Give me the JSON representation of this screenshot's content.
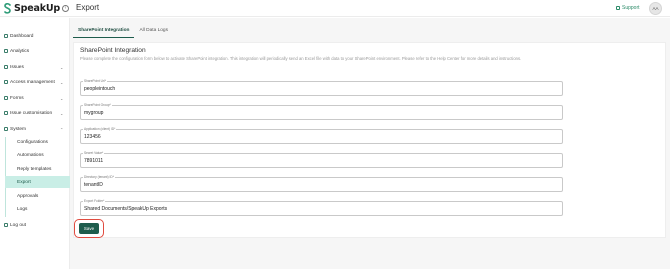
{
  "app": {
    "brand": "SpeakUp",
    "page_title": "Export",
    "support_label": "Support",
    "avatar_initials": "AA",
    "accent_color": "#1d5c4c"
  },
  "sidebar": {
    "items": [
      {
        "label": "Dashboard",
        "icon": "dashboard-icon"
      },
      {
        "label": "Analytics",
        "icon": "analytics-icon"
      },
      {
        "label": "Issues",
        "icon": "issues-icon",
        "chevron": "down"
      },
      {
        "label": "Access management",
        "icon": "access-icon",
        "chevron": "down"
      },
      {
        "label": "Forms",
        "icon": "forms-icon",
        "chevron": "down"
      },
      {
        "label": "Issue customisation",
        "icon": "customise-icon",
        "chevron": "down"
      },
      {
        "label": "System",
        "icon": "system-icon",
        "chevron": "up"
      }
    ],
    "system_subitems": [
      "Configurations",
      "Automations",
      "Reply templates",
      "Export",
      "Approvals",
      "Logs"
    ],
    "active_subitem": "Export",
    "logout_label": "Log out"
  },
  "tabs": [
    {
      "label": "SharePoint Integration",
      "active": true
    },
    {
      "label": "All Data Logs",
      "active": false
    }
  ],
  "form": {
    "title": "SharePoint Integration",
    "description": "Please complete the configuration form below to activate SharePoint integration. This integration will periodically send an Excel file with data to your SharePoint environment. Please refer to the Help Center for more details and instructions.",
    "fields": [
      {
        "label": "SharePoint Url*",
        "value": "peopleintouch"
      },
      {
        "label": "SharePoint Group*",
        "value": "mygroup"
      },
      {
        "label": "Application (client) ID*",
        "value": "123456"
      },
      {
        "label": "Secret Value*",
        "value": "7891011"
      },
      {
        "label": "Directory (tenant) ID*",
        "value": "tenantID"
      },
      {
        "label": "Export Folder*",
        "value": "Shared Documents/SpeakUp Exports"
      }
    ],
    "save_label": "Save"
  }
}
